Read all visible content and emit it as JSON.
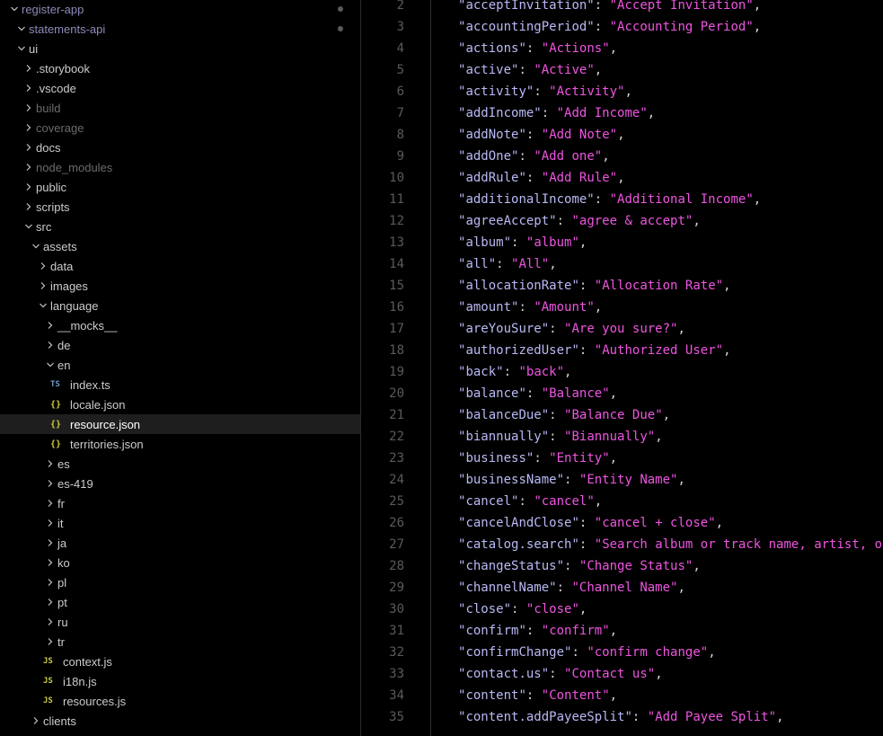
{
  "explorer": {
    "items": [
      {
        "label": "register-app",
        "depth": 0,
        "chev": "down",
        "cls": "acc",
        "dot": true
      },
      {
        "label": "statements-api",
        "depth": 1,
        "chev": "down",
        "cls": "acc",
        "dot": true
      },
      {
        "label": "ui",
        "depth": 1,
        "chev": "down",
        "cls": ""
      },
      {
        "label": ".storybook",
        "depth": 2,
        "chev": "right",
        "cls": ""
      },
      {
        "label": ".vscode",
        "depth": 2,
        "chev": "right",
        "cls": ""
      },
      {
        "label": "build",
        "depth": 2,
        "chev": "right",
        "cls": "dim"
      },
      {
        "label": "coverage",
        "depth": 2,
        "chev": "right",
        "cls": "dim"
      },
      {
        "label": "docs",
        "depth": 2,
        "chev": "right",
        "cls": ""
      },
      {
        "label": "node_modules",
        "depth": 2,
        "chev": "right",
        "cls": "dim"
      },
      {
        "label": "public",
        "depth": 2,
        "chev": "right",
        "cls": ""
      },
      {
        "label": "scripts",
        "depth": 2,
        "chev": "right",
        "cls": ""
      },
      {
        "label": "src",
        "depth": 2,
        "chev": "down",
        "cls": ""
      },
      {
        "label": "assets",
        "depth": 3,
        "chev": "down",
        "cls": ""
      },
      {
        "label": "data",
        "depth": 4,
        "chev": "right",
        "cls": ""
      },
      {
        "label": "images",
        "depth": 4,
        "chev": "right",
        "cls": ""
      },
      {
        "label": "language",
        "depth": 4,
        "chev": "down",
        "cls": ""
      },
      {
        "label": "__mocks__",
        "depth": 5,
        "chev": "right",
        "cls": ""
      },
      {
        "label": "de",
        "depth": 5,
        "chev": "right",
        "cls": ""
      },
      {
        "label": "en",
        "depth": 5,
        "chev": "down",
        "cls": ""
      },
      {
        "label": "index.ts",
        "depth": 6,
        "icon": "TS",
        "iconType": "ts",
        "cls": ""
      },
      {
        "label": "locale.json",
        "depth": 6,
        "icon": "{}",
        "iconType": "json",
        "cls": ""
      },
      {
        "label": "resource.json",
        "depth": 6,
        "icon": "{}",
        "iconType": "json",
        "cls": "sel"
      },
      {
        "label": "territories.json",
        "depth": 6,
        "icon": "{}",
        "iconType": "json",
        "cls": ""
      },
      {
        "label": "es",
        "depth": 5,
        "chev": "right",
        "cls": ""
      },
      {
        "label": "es-419",
        "depth": 5,
        "chev": "right",
        "cls": ""
      },
      {
        "label": "fr",
        "depth": 5,
        "chev": "right",
        "cls": ""
      },
      {
        "label": "it",
        "depth": 5,
        "chev": "right",
        "cls": ""
      },
      {
        "label": "ja",
        "depth": 5,
        "chev": "right",
        "cls": ""
      },
      {
        "label": "ko",
        "depth": 5,
        "chev": "right",
        "cls": ""
      },
      {
        "label": "pl",
        "depth": 5,
        "chev": "right",
        "cls": ""
      },
      {
        "label": "pt",
        "depth": 5,
        "chev": "right",
        "cls": ""
      },
      {
        "label": "ru",
        "depth": 5,
        "chev": "right",
        "cls": ""
      },
      {
        "label": "tr",
        "depth": 5,
        "chev": "right",
        "cls": ""
      },
      {
        "label": "context.js",
        "depth": 5,
        "icon": "JS",
        "iconType": "js",
        "cls": ""
      },
      {
        "label": "i18n.js",
        "depth": 5,
        "icon": "JS",
        "iconType": "js",
        "cls": ""
      },
      {
        "label": "resources.js",
        "depth": 5,
        "icon": "JS",
        "iconType": "js",
        "cls": ""
      },
      {
        "label": "clients",
        "depth": 3,
        "chev": "right",
        "cls": ""
      }
    ]
  },
  "editor": {
    "lines": [
      {
        "n": "2",
        "key": "acceptInvitation",
        "val": "Accept Invitation"
      },
      {
        "n": "3",
        "key": "accountingPeriod",
        "val": "Accounting Period"
      },
      {
        "n": "4",
        "key": "actions",
        "val": "Actions"
      },
      {
        "n": "5",
        "key": "active",
        "val": "Active"
      },
      {
        "n": "6",
        "key": "activity",
        "val": "Activity"
      },
      {
        "n": "7",
        "key": "addIncome",
        "val": "Add Income"
      },
      {
        "n": "8",
        "key": "addNote",
        "val": "Add Note"
      },
      {
        "n": "9",
        "key": "addOne",
        "val": "Add one"
      },
      {
        "n": "10",
        "key": "addRule",
        "val": "Add Rule"
      },
      {
        "n": "11",
        "key": "additionalIncome",
        "val": "Additional Income"
      },
      {
        "n": "12",
        "key": "agreeAccept",
        "val": "agree & accept"
      },
      {
        "n": "13",
        "key": "album",
        "val": "album"
      },
      {
        "n": "14",
        "key": "all",
        "val": "All"
      },
      {
        "n": "15",
        "key": "allocationRate",
        "val": "Allocation Rate"
      },
      {
        "n": "16",
        "key": "amount",
        "val": "Amount"
      },
      {
        "n": "17",
        "key": "areYouSure",
        "val": "Are you sure?"
      },
      {
        "n": "18",
        "key": "authorizedUser",
        "val": "Authorized User"
      },
      {
        "n": "19",
        "key": "back",
        "val": "back"
      },
      {
        "n": "20",
        "key": "balance",
        "val": "Balance"
      },
      {
        "n": "21",
        "key": "balanceDue",
        "val": "Balance Due"
      },
      {
        "n": "22",
        "key": "biannually",
        "val": "Biannually"
      },
      {
        "n": "23",
        "key": "business",
        "val": "Entity"
      },
      {
        "n": "24",
        "key": "businessName",
        "val": "Entity Name"
      },
      {
        "n": "25",
        "key": "cancel",
        "val": "cancel"
      },
      {
        "n": "26",
        "key": "cancelAndClose",
        "val": "cancel + close"
      },
      {
        "n": "27",
        "key": "catalog.search",
        "val": "Search album or track name, artist, or",
        "open": true
      },
      {
        "n": "28",
        "key": "changeStatus",
        "val": "Change Status"
      },
      {
        "n": "29",
        "key": "channelName",
        "val": "Channel Name"
      },
      {
        "n": "30",
        "key": "close",
        "val": "close"
      },
      {
        "n": "31",
        "key": "confirm",
        "val": "confirm"
      },
      {
        "n": "32",
        "key": "confirmChange",
        "val": "confirm change"
      },
      {
        "n": "33",
        "key": "contact.us",
        "val": "Contact us"
      },
      {
        "n": "34",
        "key": "content",
        "val": "Content"
      },
      {
        "n": "35",
        "key": "content.addPayeeSplit",
        "val": "Add Payee Split"
      }
    ]
  },
  "colors": {
    "key": "#b9b9f5",
    "value": "#ee55e0",
    "lineNumber": "#5a5a5a",
    "selection": "#1e1e1e"
  }
}
